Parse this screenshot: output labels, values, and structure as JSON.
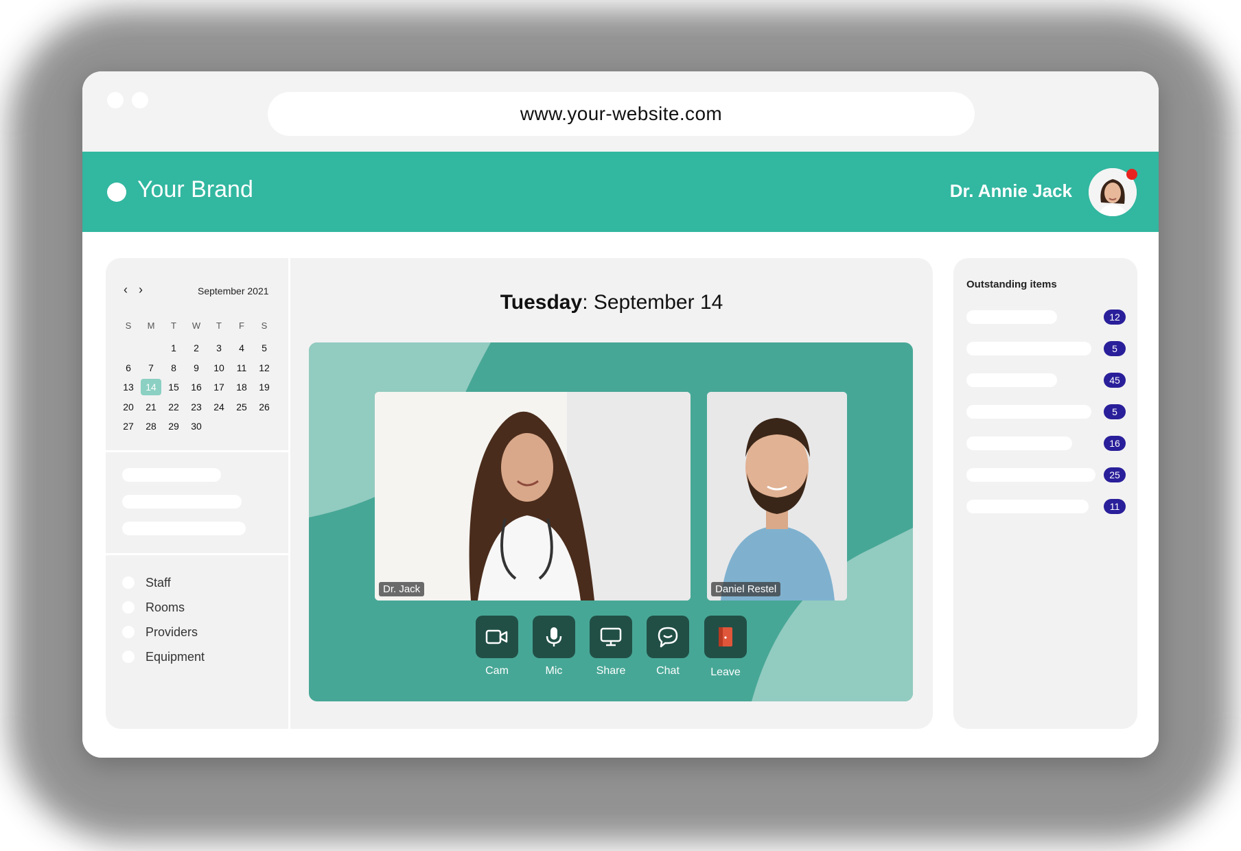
{
  "browser": {
    "url": "www.your-website.com"
  },
  "header": {
    "brand": "Your Brand",
    "user_name": "Dr. Annie Jack"
  },
  "calendar": {
    "month_label": "September 2021",
    "weekdays": [
      "S",
      "M",
      "T",
      "W",
      "T",
      "F",
      "S"
    ],
    "today": "14",
    "weeks": [
      [
        "",
        "",
        "1",
        "2",
        "3",
        "4",
        "5"
      ],
      [
        "6",
        "7",
        "8",
        "9",
        "10",
        "11",
        "12"
      ],
      [
        "13",
        "14",
        "15",
        "16",
        "17",
        "18",
        "19"
      ],
      [
        "20",
        "21",
        "22",
        "23",
        "24",
        "25",
        "26"
      ],
      [
        "27",
        "28",
        "29",
        "30",
        "",
        "",
        ""
      ]
    ]
  },
  "filters": {
    "items": [
      "Staff",
      "Rooms",
      "Providers",
      "Equipment"
    ]
  },
  "main": {
    "date_day": "Tuesday",
    "date_rest": ": September 14",
    "participants": [
      "Dr. Jack",
      "Daniel Restel"
    ],
    "controls": {
      "cam": "Cam",
      "mic": "Mic",
      "share": "Share",
      "chat": "Chat",
      "leave": "Leave"
    }
  },
  "outstanding": {
    "title": "Outstanding items",
    "counts": [
      "12",
      "5",
      "45",
      "5",
      "16",
      "25",
      "11"
    ]
  },
  "colors": {
    "brand": "#32b7a0",
    "stage": "#47a796",
    "badge": "#2a1f9a",
    "leave": "#e0563b"
  }
}
